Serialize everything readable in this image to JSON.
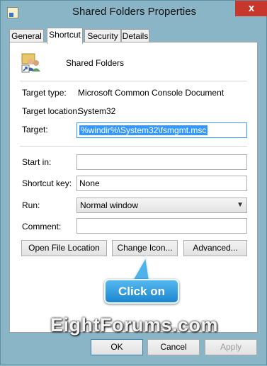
{
  "window": {
    "title": "Shared Folders Properties",
    "close_glyph": "x"
  },
  "tabs": [
    {
      "label": "General"
    },
    {
      "label": "Shortcut",
      "active": true
    },
    {
      "label": "Security"
    },
    {
      "label": "Details"
    }
  ],
  "shortcut": {
    "name": "Shared Folders",
    "icon": "shared-folders-users-icon",
    "target_type_label": "Target type:",
    "target_type_value": "Microsoft Common Console Document",
    "target_location_label": "Target location:",
    "target_location_value": "System32",
    "target_label": "Target:",
    "target_value": "%windir%\\System32\\fsmgmt.msc",
    "start_in_label": "Start in:",
    "start_in_value": "",
    "shortcut_key_label": "Shortcut key:",
    "shortcut_key_value": "None",
    "run_label": "Run:",
    "run_value": "Normal window",
    "comment_label": "Comment:",
    "comment_value": ""
  },
  "buttons": {
    "open_file_location": "Open File Location",
    "change_icon": "Change Icon...",
    "advanced": "Advanced...",
    "ok": "OK",
    "cancel": "Cancel",
    "apply": "Apply"
  },
  "callout": {
    "text": "Click on"
  },
  "watermark": {
    "text": "EightForums.com"
  },
  "colors": {
    "window_frame": "#8ab5c7",
    "close_button": "#c7372d",
    "selection": "#3399ff",
    "callout": "#1c86d0"
  }
}
